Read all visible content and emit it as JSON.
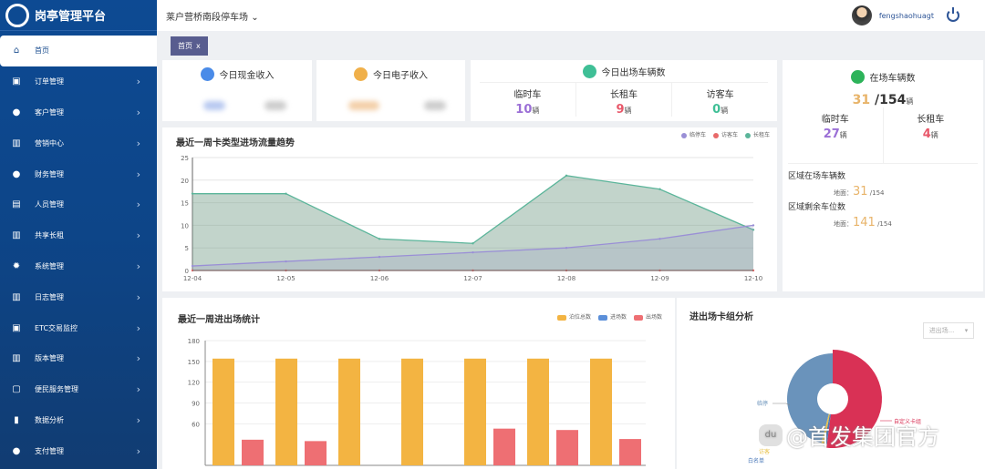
{
  "app": {
    "title": "岗亭管理平台"
  },
  "header": {
    "parking_lot": "莱户营桥南段停车场",
    "username": "fengshaohuagt"
  },
  "tabs": [
    {
      "label": "首页",
      "close": "x"
    }
  ],
  "sidebar": {
    "items": [
      {
        "label": "首页",
        "icon": "home-icon",
        "active": true
      },
      {
        "label": "订单管理",
        "icon": "clipboard-icon"
      },
      {
        "label": "客户管理",
        "icon": "user-icon"
      },
      {
        "label": "营销中心",
        "icon": "building-icon"
      },
      {
        "label": "财务管理",
        "icon": "money-bag-icon"
      },
      {
        "label": "人员管理",
        "icon": "id-card-icon"
      },
      {
        "label": "共享长租",
        "icon": "building-icon"
      },
      {
        "label": "系统管理",
        "icon": "gear-icon"
      },
      {
        "label": "日志管理",
        "icon": "building-icon"
      },
      {
        "label": "ETC交易监控",
        "icon": "clipboard-icon"
      },
      {
        "label": "版本管理",
        "icon": "building-icon"
      },
      {
        "label": "便民服务管理",
        "icon": "train-icon"
      },
      {
        "label": "数据分析",
        "icon": "bar-chart-icon"
      },
      {
        "label": "支付管理",
        "icon": "money-bag-icon"
      }
    ]
  },
  "stats": {
    "cash": {
      "title": "今日现金收入",
      "color": "#4a8be8"
    },
    "electronic": {
      "title": "今日电子收入",
      "color": "#f0b04a"
    },
    "exit": {
      "title": "今日出场车辆数",
      "items": [
        {
          "label": "临时车",
          "value": "10",
          "unit": "辆",
          "color": "#9b6fd6"
        },
        {
          "label": "长租车",
          "value": "9",
          "unit": "辆",
          "color": "#e8586a"
        },
        {
          "label": "访客车",
          "value": "0",
          "unit": "辆",
          "color": "#3fbf96"
        }
      ]
    },
    "onsite": {
      "title": "在场车辆数",
      "current": "31",
      "total": "/154",
      "unit": "辆",
      "items": [
        {
          "label": "临时车",
          "value": "27",
          "unit": "辆",
          "color": "#9b6fd6"
        },
        {
          "label": "长租车",
          "value": "4",
          "unit": "辆",
          "color": "#e8586a"
        }
      ],
      "region_count_title": "区域在场车辆数",
      "region_count_label": "地面：",
      "region_count_value": "31",
      "region_count_total": "/154",
      "region_free_title": "区域剩余车位数",
      "region_free_label": "地面：",
      "region_free_value": "141",
      "region_free_total": "/154"
    }
  },
  "chart_data": [
    {
      "type": "area",
      "title": "最近一周卡类型进场流量趋势",
      "categories": [
        "12-04",
        "12-05",
        "12-06",
        "12-07",
        "12-08",
        "12-09",
        "12-10"
      ],
      "ylim": [
        0,
        25
      ],
      "yticks": [
        0,
        5,
        10,
        15,
        20,
        25
      ],
      "grid": true,
      "legend": "top-right",
      "series": [
        {
          "name": "临停车",
          "color": "#9a8fd6",
          "values": [
            1,
            2,
            3,
            4,
            5,
            7,
            10
          ]
        },
        {
          "name": "访客车",
          "color": "#e86a6a",
          "values": [
            0,
            0,
            0,
            0,
            0,
            0,
            0
          ]
        },
        {
          "name": "长租车",
          "color": "#5bb59a",
          "values": [
            17,
            17,
            7,
            6,
            21,
            18,
            9
          ]
        }
      ]
    },
    {
      "type": "bar",
      "title": "最近一周进出场统计",
      "ylim": [
        0,
        180
      ],
      "yticks": [
        60,
        90,
        120,
        150,
        180
      ],
      "grid": true,
      "legend": "top-right",
      "series": [
        {
          "name": "泊位总数",
          "color": "#f3b442",
          "values": [
            154,
            154,
            154,
            154,
            154,
            154,
            154
          ]
        },
        {
          "name": "进场数",
          "color": "#5b8fd9",
          "values": [
            null,
            null,
            null,
            null,
            null,
            null,
            null
          ]
        },
        {
          "name": "出场数",
          "color": "#ee6f73",
          "values": [
            37,
            35,
            null,
            null,
            53,
            51,
            38
          ]
        }
      ]
    },
    {
      "type": "pie",
      "title": "进出场卡组分析",
      "select": "进出场...",
      "slices": [
        {
          "name": "自定义卡组",
          "color": "#d93155",
          "value": 52
        },
        {
          "name": "白名单",
          "color": "#4a78b8",
          "value": 1
        },
        {
          "name": "访客",
          "color": "#e8c24a",
          "value": 1
        },
        {
          "name": "临停",
          "color": "#6a93bb",
          "value": 46
        }
      ]
    }
  ],
  "watermark": "@首发集团官方"
}
